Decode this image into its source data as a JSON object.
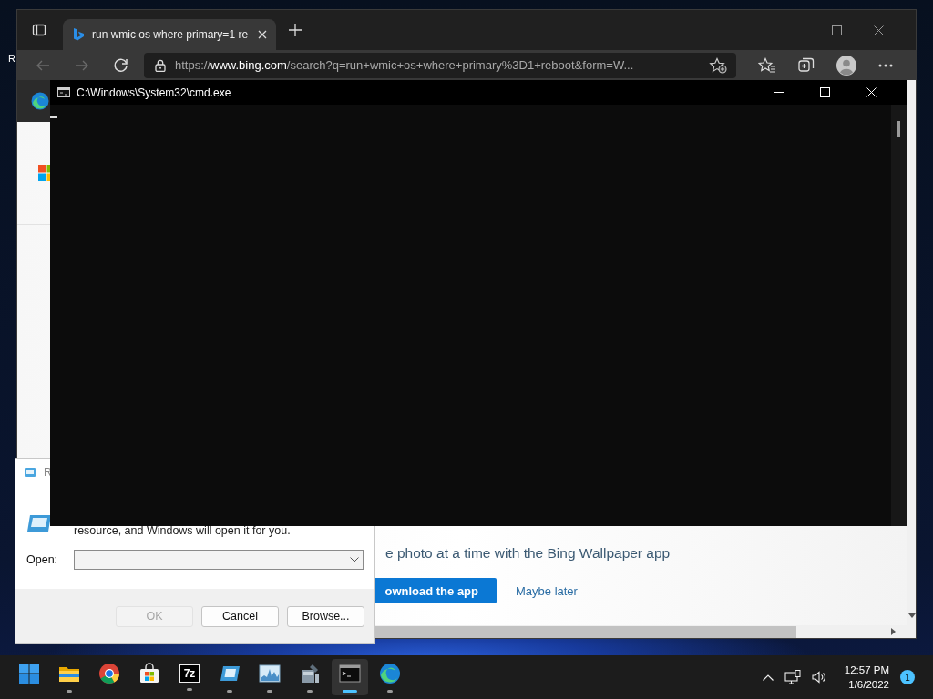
{
  "desktop": {
    "icon_label": "R"
  },
  "browser": {
    "tabs": [
      {
        "title": "run wmic os where primary=1 re",
        "selected": true
      }
    ],
    "nav_buttons": [
      {
        "kind": "back",
        "disabled": true
      },
      {
        "kind": "forward",
        "disabled": true
      },
      {
        "kind": "refresh",
        "disabled": false
      }
    ],
    "address": "https://**www.bing.com**/search?q=run+wmic+os+where+primary%3D1+reboot&form=W...",
    "page": {
      "promo_text": "e photo at a time with the Bing Wallpaper app",
      "primary_button": "ownload the app",
      "secondary_link": "Maybe later"
    }
  },
  "console": {
    "title": "C:\\Windows\\System32\\cmd.exe"
  },
  "run_dialog": {
    "title": "R",
    "description": "resource, and Windows will open it for you.",
    "open_label": "Open:",
    "buttons": [
      {
        "label": "OK",
        "disabled": true
      },
      {
        "label": "Cancel",
        "disabled": false
      },
      {
        "label": "Browse...",
        "disabled": false
      }
    ]
  },
  "taskbar": {
    "apps": [
      {
        "kind": "start",
        "running": false,
        "active": false
      },
      {
        "kind": "explorer",
        "running": true,
        "active": false
      },
      {
        "kind": "chrome",
        "running": false,
        "active": false
      },
      {
        "kind": "store",
        "running": false,
        "active": false
      },
      {
        "kind": "sevenzip",
        "icon_text": "7z",
        "running": true,
        "active": false
      },
      {
        "kind": "run",
        "running": true,
        "active": false
      },
      {
        "kind": "monitor",
        "running": true,
        "active": false
      },
      {
        "kind": "tools",
        "running": true,
        "active": false
      },
      {
        "kind": "console",
        "running": true,
        "active": true
      },
      {
        "kind": "edge",
        "running": true,
        "active": false
      }
    ],
    "clock": {
      "time": "12:57 PM",
      "date": "1/6/2022"
    },
    "notification_count": "1"
  }
}
